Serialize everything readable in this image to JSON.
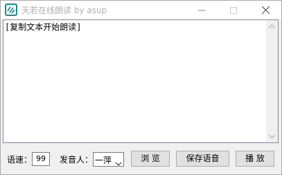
{
  "window": {
    "title": "天若在线朗读 by asup",
    "controls": [
      "minimize",
      "maximize",
      "close"
    ]
  },
  "editor": {
    "text": "[复制文本开始朗读]"
  },
  "toolbar": {
    "speed_label": "语速：",
    "speed_value": "99",
    "voice_label": "发音人：",
    "voice_value": "一萍",
    "browse_label": "浏 览",
    "save_label": "保存语音",
    "play_label": "播 放"
  },
  "icons": {
    "app": "text-to-speech-icon",
    "minimize": "minimize-icon",
    "maximize": "maximize-icon",
    "close": "close-icon",
    "dropdown": "chevron-down-icon"
  },
  "colors": {
    "titlebar": "#ffffff",
    "body": "#f0f0f0",
    "button": "#e1e1e1",
    "app_icon": "#1a8a8a"
  }
}
